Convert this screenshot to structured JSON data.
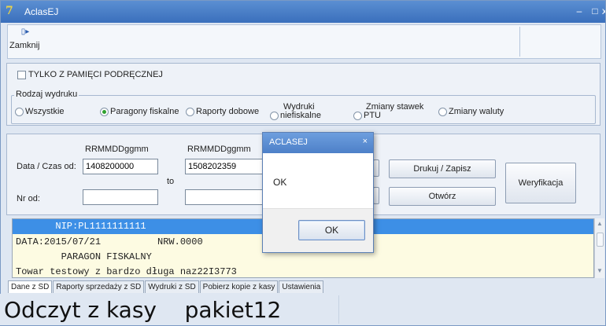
{
  "window": {
    "title": "AclasEJ",
    "app_icon": "7"
  },
  "toolbar": {
    "close_label": "Zamknij",
    "close_icon": "exit-icon"
  },
  "options": {
    "cache_only_label": "TYLKO Z PAMIĘCI PODRĘCZNEJ",
    "cache_only_checked": false
  },
  "print_type": {
    "title": "Rodzaj wydruku",
    "options": [
      {
        "label": "Wszystkie",
        "selected": false
      },
      {
        "label": "Paragony fiskalne",
        "selected": true
      },
      {
        "label": "Raporty dobowe",
        "selected": false
      },
      {
        "label_line1": "Wydruki",
        "label_line2": "niefiskalne",
        "selected": false
      },
      {
        "label_line1": "Zmiany stawek",
        "label_line2": "PTU",
        "selected": false
      },
      {
        "label": "Zmiany waluty",
        "selected": false
      }
    ]
  },
  "filters": {
    "format_hint_from": "RRMMDDggmm",
    "format_hint_to": "RRMMDDggmm",
    "date_from_label": "Data / Czas od:",
    "date_from_value": "1408200000",
    "to_label": "to",
    "date_to_value": "1508202359",
    "nr_from_label": "Nr od:",
    "nr_from_value": "",
    "nr_to_value": ""
  },
  "actions": {
    "print_save_label": "Drukuj / Zapisz",
    "open_label": "Otwórz",
    "verify_label": "Weryfikacja"
  },
  "printout": {
    "lines": [
      "       NIP:PL1111111111",
      "DATA:2015/07/21          NRW.0000",
      "        PARAGON FISKALNY",
      "Towar testowy z bardzo długa naz22I3773"
    ]
  },
  "tabs": [
    "Dane z SD",
    "Raporty sprzedaży z SD",
    "Wydruki z SD",
    "Pobierz kopie z kasy",
    "Ustawienia"
  ],
  "status": {
    "text": "Odczyt z kasy    pakiet12"
  },
  "dialog": {
    "title": "ACLASEJ",
    "message": "OK",
    "ok_label": "OK"
  }
}
